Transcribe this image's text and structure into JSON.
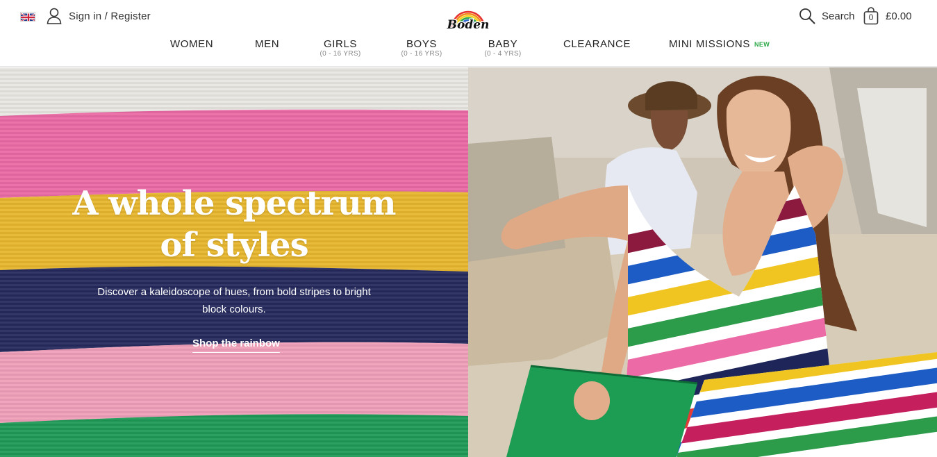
{
  "header": {
    "account_label": "Sign in / Register",
    "search_label": "Search",
    "bag_count": "0",
    "bag_total": "£0.00"
  },
  "nav": {
    "items": [
      {
        "label": "WOMEN",
        "sub": ""
      },
      {
        "label": "MEN",
        "sub": ""
      },
      {
        "label": "GIRLS",
        "sub": "(0 - 16 YRS)"
      },
      {
        "label": "BOYS",
        "sub": "(0 - 16 YRS)"
      },
      {
        "label": "BABY",
        "sub": "(0 - 4 YRS)"
      },
      {
        "label": "CLEARANCE",
        "sub": ""
      },
      {
        "label": "MINI MISSIONS",
        "sub": "",
        "badge": "NEW"
      }
    ]
  },
  "hero": {
    "title_line1": "A whole spectrum",
    "title_line2": "of styles",
    "description": "Discover a kaleidoscope of hues, from bold stripes to bright block colours.",
    "cta": "Shop the rainbow"
  },
  "colors": {
    "accent_new": "#28a745",
    "stripe_pink": "#ea6aa5",
    "stripe_yellow": "#e8b72e",
    "stripe_navy": "#252a5e",
    "stripe_light_pink": "#ef9fb9",
    "stripe_green": "#1f9a57"
  },
  "icons": {
    "flag": "uk-flag-icon",
    "account": "user-icon",
    "search": "search-icon",
    "bag": "shopping-bag-icon",
    "logo": "boden-rainbow-logo"
  }
}
